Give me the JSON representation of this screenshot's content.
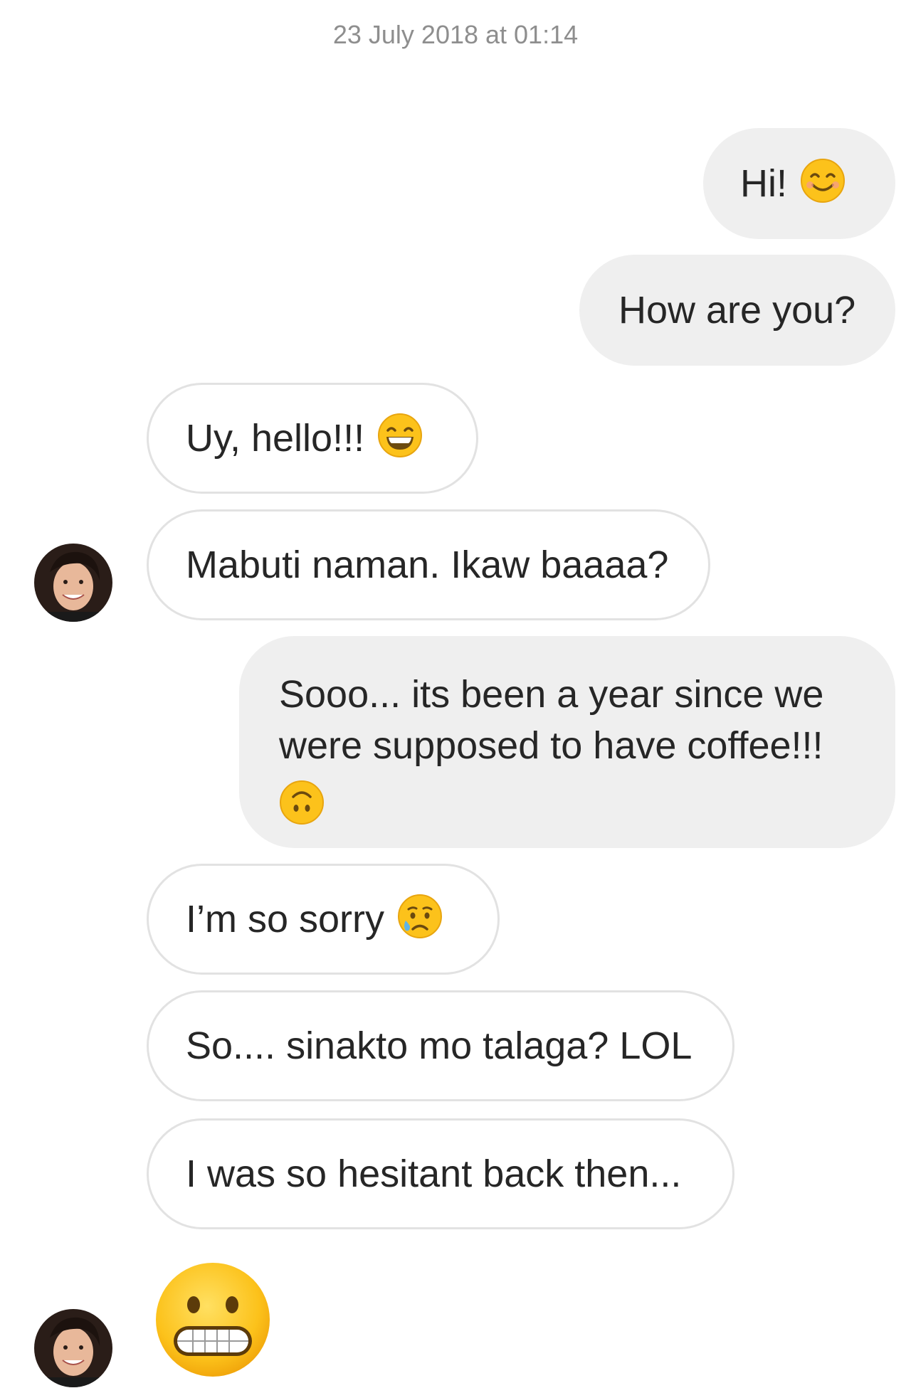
{
  "conversation": {
    "timestamp": "23 July 2018 at 01:14",
    "messages": [
      {
        "sender": "me",
        "text": "Hi!",
        "emoji": "smiling-face-icon"
      },
      {
        "sender": "me",
        "text": "How are you?"
      },
      {
        "sender": "them",
        "text": "Uy, hello!!!",
        "emoji": "grinning-face-icon"
      },
      {
        "sender": "them",
        "text": "Mabuti naman. Ikaw baaaa?"
      },
      {
        "sender": "me",
        "text": "Sooo... its been a year since we were supposed to have coffee!!!",
        "emoji": "upside-down-face-icon"
      },
      {
        "sender": "them",
        "text": "I’m so sorry",
        "emoji": "crying-face-icon"
      },
      {
        "sender": "them",
        "text": "So.... sinakto mo talaga? LOL"
      },
      {
        "sender": "them",
        "text": "I was so hesitant back then..."
      },
      {
        "sender": "them",
        "emoji": "grimacing-face-icon"
      }
    ]
  },
  "colors": {
    "outgoing_bubble": "#efefef",
    "incoming_border": "#e2e2e2",
    "timestamp_text": "#8e8e8e",
    "message_text": "#262626",
    "emoji_yellow": "#fcc21b"
  }
}
